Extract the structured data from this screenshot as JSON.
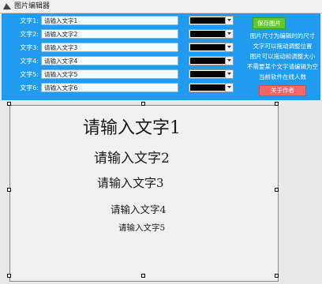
{
  "window": {
    "title": "图片编辑器",
    "icon": "image-editor-app-icon"
  },
  "rows": [
    {
      "label": "文字1:",
      "value": "请输入文字1",
      "color": "#000000"
    },
    {
      "label": "文字2:",
      "value": "请输入文字2",
      "color": "#000000"
    },
    {
      "label": "文字3:",
      "value": "请输入文字3",
      "color": "#000000"
    },
    {
      "label": "文字4:",
      "value": "请输入文字4",
      "color": "#000000"
    },
    {
      "label": "文字5:",
      "value": "请输入文字5",
      "color": "#000000"
    },
    {
      "label": "文字6:",
      "value": "请输入文字6",
      "color": "#000000"
    }
  ],
  "buttons": {
    "save": "保存图片",
    "about": "关于作者"
  },
  "info": [
    "图片尺寸为编辑时的尺寸",
    "文字可以拖动调整位置",
    "图片可以拖动和调整大小",
    "不需要某个文字请编辑为空",
    "当前软件在线人数"
  ],
  "canvas_texts": [
    "请输入文字1",
    "请输入文字2",
    "请输入文字3",
    "请输入文字4",
    "请输入文字5"
  ],
  "colors": {
    "panel": "#1f9cf0",
    "save_button": "#5fc92e",
    "about_button": "#f1666b",
    "canvas": "#f0f0f0"
  }
}
